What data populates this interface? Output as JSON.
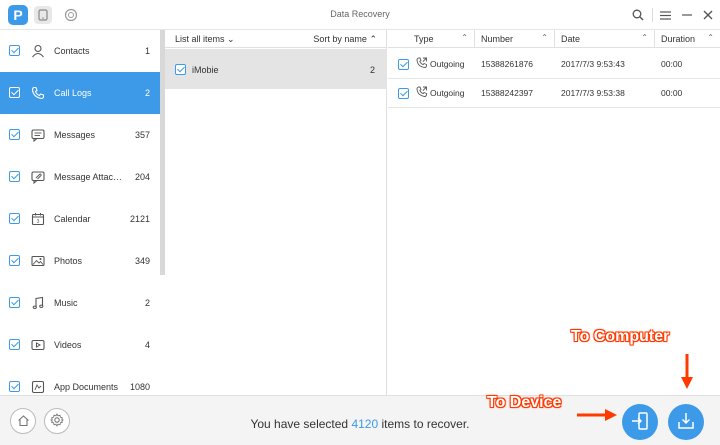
{
  "window": {
    "title": "Data Recovery",
    "logo_letter": "P"
  },
  "sidebar": {
    "items": [
      {
        "label": "Contacts",
        "count": "1",
        "icon": "person-icon",
        "active": false
      },
      {
        "label": "Call Logs",
        "count": "2",
        "icon": "phone-icon",
        "active": true
      },
      {
        "label": "Messages",
        "count": "357",
        "icon": "message-icon",
        "active": false
      },
      {
        "label": "Message Attachments",
        "count": "204",
        "icon": "attachment-icon",
        "active": false
      },
      {
        "label": "Calendar",
        "count": "2121",
        "icon": "calendar-icon",
        "active": false
      },
      {
        "label": "Photos",
        "count": "349",
        "icon": "photo-icon",
        "active": false
      },
      {
        "label": "Music",
        "count": "2",
        "icon": "music-icon",
        "active": false
      },
      {
        "label": "Videos",
        "count": "4",
        "icon": "video-icon",
        "active": false
      },
      {
        "label": "App Documents",
        "count": "1080",
        "icon": "app-documents-icon",
        "active": false
      }
    ]
  },
  "middle": {
    "list_label": "List all items",
    "sort_label": "Sort by name",
    "rows": [
      {
        "name": "iMobie",
        "count": "2"
      }
    ]
  },
  "table": {
    "columns": [
      "Type",
      "Number",
      "Date",
      "Duration"
    ],
    "rows": [
      {
        "type": "Outgoing",
        "number": "15388261876",
        "date": "2017/7/3 9:53:43",
        "duration": "00:00"
      },
      {
        "type": "Outgoing",
        "number": "15388242397",
        "date": "2017/7/3 9:53:38",
        "duration": "00:00"
      }
    ]
  },
  "status": {
    "prefix": "You have selected ",
    "count": "4120",
    "suffix": " items to recover."
  },
  "annotations": {
    "to_computer": "To Computer",
    "to_device": "To Device"
  },
  "colors": {
    "accent": "#3d9ae8",
    "annotation_outline": "#ff3a00"
  }
}
